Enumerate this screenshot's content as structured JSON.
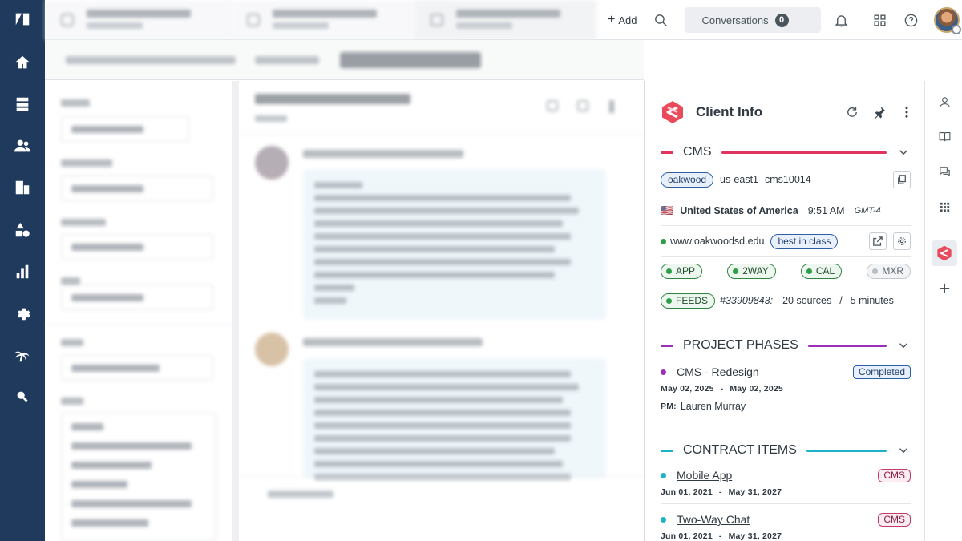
{
  "topbar": {
    "add_label": "Add",
    "conversations_label": "Conversations",
    "conversations_count": "0"
  },
  "client_info": {
    "title": "Client Info",
    "cms": {
      "section_title": "CMS",
      "color": "#e0335e",
      "tag": "oakwood",
      "region": "us-east1",
      "instance": "cms10014",
      "country_flag": "🇺🇸",
      "country": "United States of America",
      "time": "9:51 AM",
      "timezone": "GMT-4",
      "website": "www.oakwoodsd.edu",
      "website_tag": "best in class",
      "features": [
        {
          "label": "APP",
          "active": true
        },
        {
          "label": "2WAY",
          "active": true
        },
        {
          "label": "CAL",
          "active": true
        },
        {
          "label": "MXR",
          "active": false
        }
      ],
      "feeds_label": "FEEDS",
      "feeds_id": "#33909843:",
      "feeds_sources": "20 sources",
      "feeds_sep": "/",
      "feeds_interval": "5 minutes"
    },
    "project_phases": {
      "section_title": "PROJECT PHASES",
      "color": "#9b30b8",
      "items": [
        {
          "title": "CMS - Redesign",
          "status": "Completed",
          "start": "May 02, 2025",
          "sep": "-",
          "end": "May 02, 2025",
          "pm_label": "PM:",
          "pm": "Lauren Murray"
        }
      ]
    },
    "contract_items": {
      "section_title": "CONTRACT ITEMS",
      "color": "#1cb3c8",
      "items": [
        {
          "title": "Mobile App",
          "tag": "CMS",
          "start": "Jun 01, 2021",
          "sep": "-",
          "end": "May 31, 2027"
        },
        {
          "title": "Two-Way Chat",
          "tag": "CMS",
          "start": "Jun 01, 2021",
          "sep": "-",
          "end": "May 31, 2027"
        }
      ]
    }
  }
}
